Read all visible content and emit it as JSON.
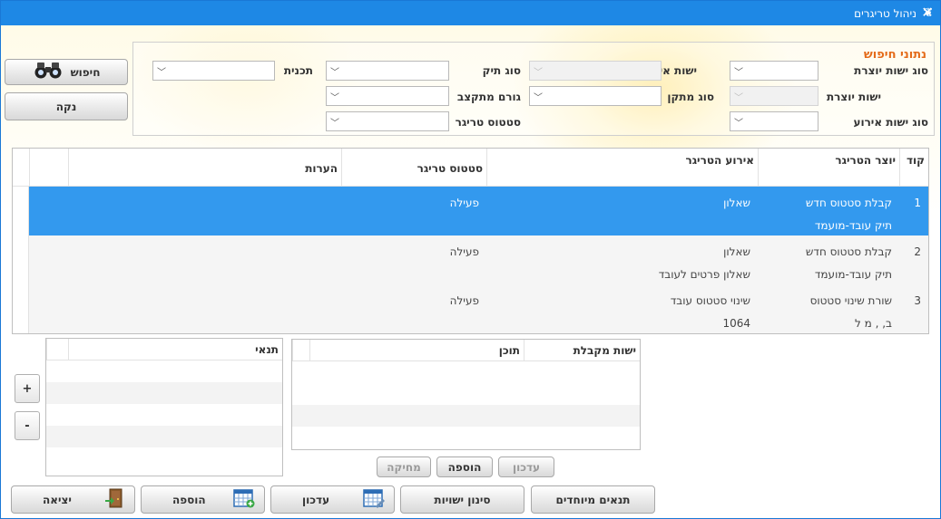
{
  "window": {
    "title": "ניהול טריגרים",
    "close_glyph": "✕",
    "app_icon_glyph": "❦"
  },
  "search": {
    "title": "נתוני חיפוש",
    "labels": {
      "creating_entity_type": "סוג ישות יוצרת",
      "event_entity": "ישות אירוע",
      "file_type": "סוג תיק",
      "plan": "תכנית",
      "creating_entity": "ישות יוצרת",
      "corrector_type": "סוג מתקן",
      "allocated_factor": "גורם מתקצב",
      "event_entity_type": "סוג ישות אירוע",
      "trigger_status": "סטטוס טריגר"
    }
  },
  "buttons": {
    "search": "חיפוש",
    "clear": "נקה",
    "update_sub": "עדכון",
    "add_sub": "הוספה",
    "delete_sub": "מחיקה",
    "special_conditions": "תנאים מיוחדים",
    "entity_filter": "סינון ישויות",
    "update": "עדכון",
    "add": "הוספה",
    "exit": "יציאה",
    "plus": "+",
    "minus": "-"
  },
  "grid": {
    "columns": {
      "code": "קוד",
      "trigger_creator": "יוצר הטריגר",
      "trigger_event": "אירוע הטריגר",
      "trigger_status": "סטטוס טריגר",
      "notes": "הערות"
    },
    "rows": [
      {
        "code": "1",
        "creator_1": "קבלת סטטוס חדש",
        "creator_2": "תיק עובד-מועמד",
        "event_1": "שאלון",
        "event_2": "",
        "status": "פעילה",
        "notes": ""
      },
      {
        "code": "2",
        "creator_1": "קבלת סטטוס חדש",
        "creator_2": "תיק עובד-מועמד",
        "event_1": "שאלון",
        "event_2": "שאלון פרטים לעובד",
        "status": "פעילה",
        "notes": ""
      },
      {
        "code": "3",
        "creator_1": "שורת שינוי סטטוס",
        "creator_2": "ב, , מ ל",
        "event_1": "שינוי סטטוס עובד",
        "event_2": "1064",
        "status": "פעילה",
        "notes": ""
      }
    ]
  },
  "receiving_grid": {
    "columns": {
      "receiving_entity": "ישות מקבלת",
      "content": "תוכן"
    }
  },
  "condition_grid": {
    "columns": {
      "condition": "תנאי"
    }
  },
  "colors": {
    "titlebar": "#1e88e5",
    "selected_row": "#3399ee",
    "panel_title": "#e46b1a"
  }
}
